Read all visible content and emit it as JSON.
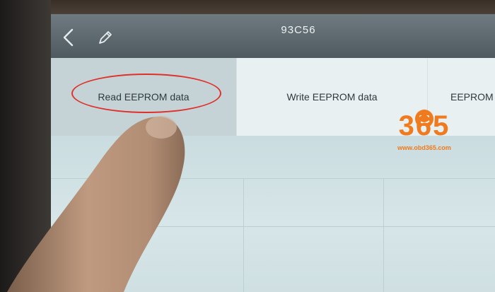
{
  "header": {
    "title": "93C56",
    "back_icon": "chevron-left-icon",
    "edit_icon": "pencil-icon"
  },
  "tabs": [
    {
      "label": "Read EEPROM data",
      "active": true
    },
    {
      "label": "Write EEPROM data",
      "active": false
    },
    {
      "label": "EEPROM i",
      "active": false
    }
  ],
  "annotation": {
    "color": "#e0302c"
  },
  "watermark": {
    "digits": "365",
    "site": "www.obd365.com",
    "color": "#f07a1e"
  }
}
